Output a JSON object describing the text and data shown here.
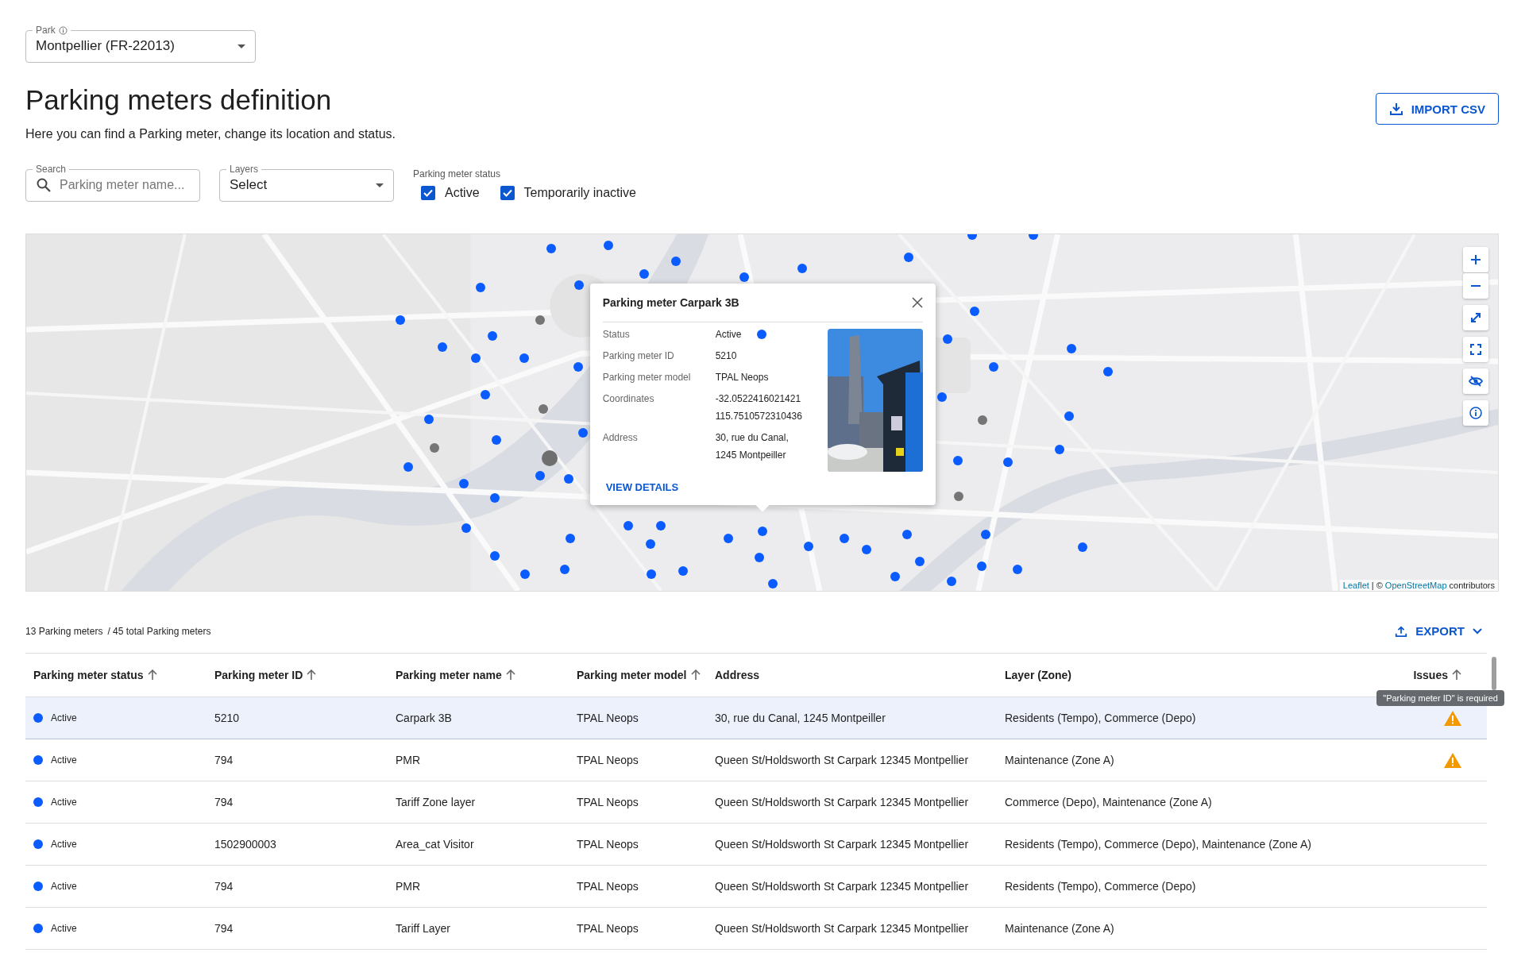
{
  "park_field": {
    "label": "Park",
    "value": "Montpellier (FR-22013)"
  },
  "page": {
    "title": "Parking meters definition",
    "subtitle": "Here you can find a Parking meter, change its location and status."
  },
  "import_button": {
    "label": "IMPORT CSV"
  },
  "filters": {
    "search": {
      "label": "Search",
      "placeholder": "Parking meter name..."
    },
    "layers": {
      "label": "Layers",
      "value": "Select"
    },
    "status": {
      "label": "Parking meter status",
      "options": [
        {
          "label": "Active",
          "checked": true
        },
        {
          "label": "Temporarily inactive",
          "checked": true
        }
      ]
    }
  },
  "map": {
    "popup": {
      "title": "Parking meter Carpark 3B",
      "fields": [
        {
          "label": "Status",
          "lines": [
            "Active"
          ],
          "color": "#0a5cff"
        },
        {
          "label": "Parking meter ID",
          "lines": [
            "5210"
          ]
        },
        {
          "label": "Parking meter model",
          "lines": [
            "TPAL Neops"
          ]
        },
        {
          "label": "Coordinates",
          "lines": [
            "-32.0522416021421",
            "115.7510572310436"
          ]
        },
        {
          "label": "Address",
          "lines": [
            "30, rue du Canal,",
            "1245 Montpeiller"
          ]
        }
      ],
      "link": "VIEW DETAILS"
    },
    "attribution": {
      "leaflet": "Leaflet",
      "separator": "| ©",
      "osm": "OpenStreetMap",
      "rest": "contributors"
    }
  },
  "summary": {
    "count": "13 Parking meters",
    "total": "/ 45 total Parking meters"
  },
  "export_button": {
    "label": "EXPORT"
  },
  "table": {
    "columns": [
      {
        "label": "Parking meter status",
        "sortable": true
      },
      {
        "label": "Parking meter ID",
        "sortable": true
      },
      {
        "label": "Parking meter name",
        "sortable": true
      },
      {
        "label": "Parking meter model",
        "sortable": true
      },
      {
        "label": "Address",
        "sortable": false
      },
      {
        "label": "Layer (Zone)",
        "sortable": false
      },
      {
        "label": "Issues",
        "sortable": true
      }
    ],
    "tooltip": "\"Parking meter ID\" is required",
    "rows": [
      {
        "selected": true,
        "status": "Active",
        "color": "#0a5cff",
        "id": "5210",
        "name": "Carpark 3B",
        "model": "TPAL Neops",
        "address": "30, rue du Canal, 1245 Montpeiller",
        "layer": "Residents (Tempo), Commerce (Depo)",
        "issue": true
      },
      {
        "selected": false,
        "status": "Active",
        "color": "#0a5cff",
        "id": "794",
        "name": "PMR",
        "model": "TPAL Neops",
        "address": "Queen St/Holdsworth St Carpark 12345 Montpellier",
        "layer": "Maintenance (Zone A)",
        "issue": true
      },
      {
        "selected": false,
        "status": "Active",
        "color": "#0a5cff",
        "id": "794",
        "name": "Tariff Zone layer",
        "model": "TPAL Neops",
        "address": "Queen St/Holdsworth St Carpark 12345 Montpellier",
        "layer": "Commerce (Depo), Maintenance (Zone A)",
        "issue": false
      },
      {
        "selected": false,
        "status": "Active",
        "color": "#0a5cff",
        "id": "1502900003",
        "name": "Area_cat Visitor",
        "model": "TPAL Neops",
        "address": "Queen St/Holdsworth St Carpark 12345 Montpellier",
        "layer": "Residents (Tempo), Commerce (Depo), Maintenance (Zone A)",
        "issue": false
      },
      {
        "selected": false,
        "status": "Active",
        "color": "#0a5cff",
        "id": "794",
        "name": "PMR",
        "model": "TPAL Neops",
        "address": "Queen St/Holdsworth St Carpark 12345 Montpellier",
        "layer": "Residents (Tempo), Commerce (Depo)",
        "issue": false
      },
      {
        "selected": false,
        "status": "Active",
        "color": "#0a5cff",
        "id": "794",
        "name": "Tariff Layer",
        "model": "TPAL Neops",
        "address": "Queen St/Holdsworth St Carpark 12345 Montpellier",
        "layer": "Maintenance (Zone A)",
        "issue": false
      }
    ]
  }
}
